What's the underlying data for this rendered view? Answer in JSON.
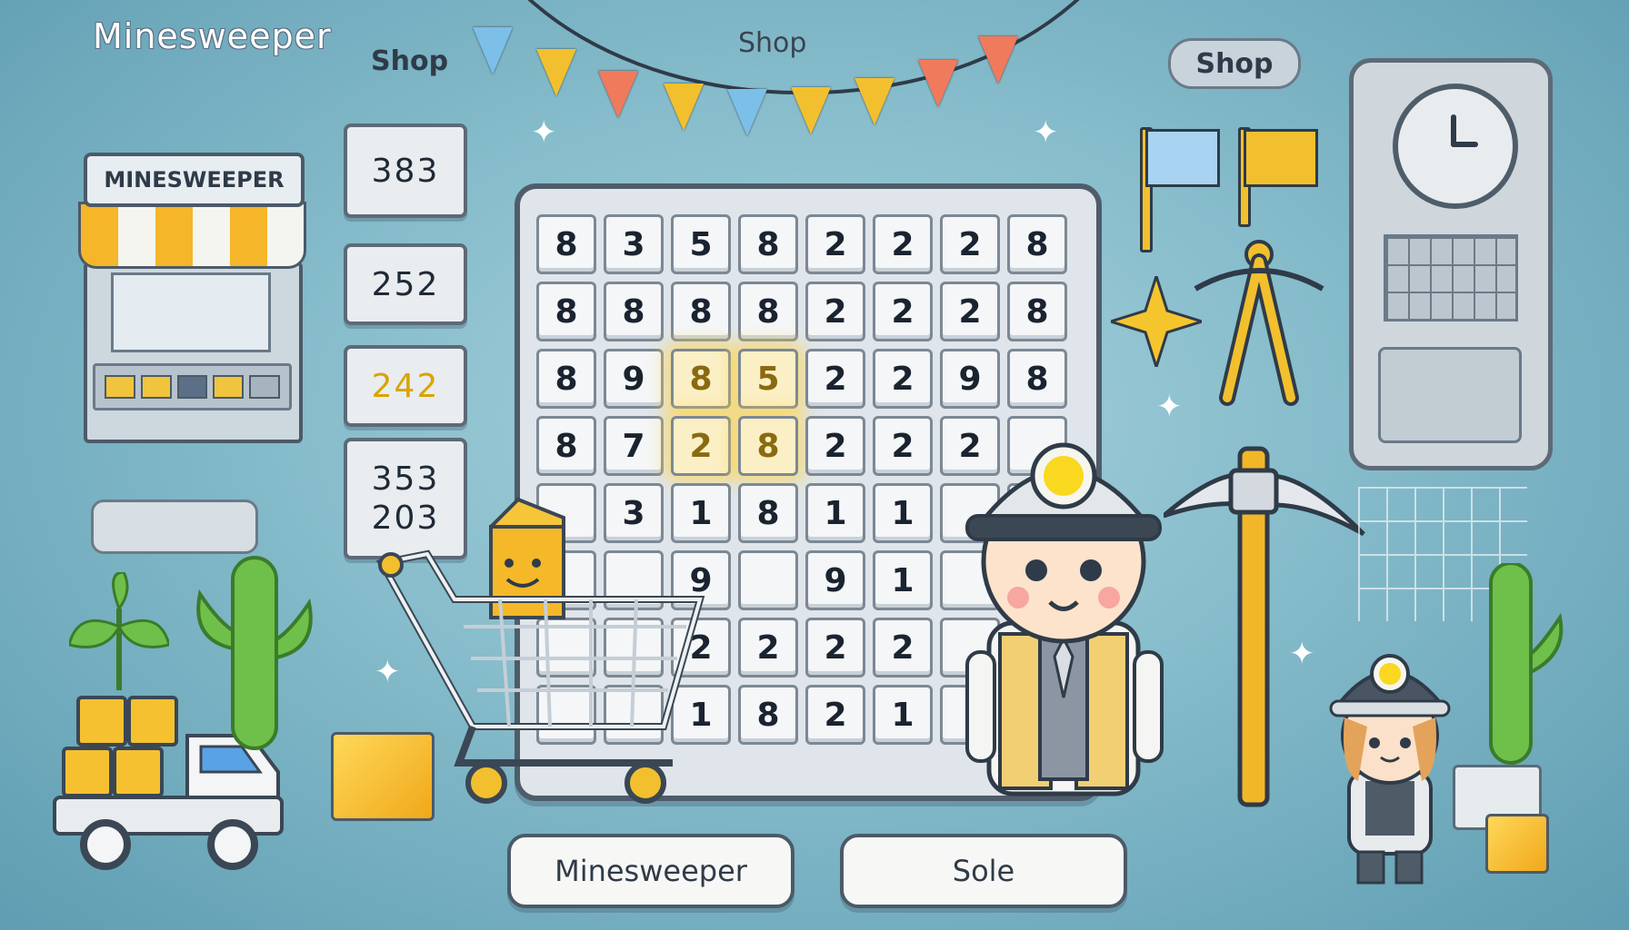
{
  "header": {
    "app_title": "Minesweeper",
    "shop_left": "Shop",
    "shop_center": "Shop",
    "shop_button": "Shop"
  },
  "stall": {
    "sign": "MINESWEEPER"
  },
  "panels": {
    "panel_1": "383",
    "panel_2": "252",
    "panel_3": "242",
    "panel_4_row1": "353",
    "panel_4_row2": "203"
  },
  "grid": {
    "rows": [
      [
        "8",
        "3",
        "5",
        "8",
        "2",
        "2",
        "2",
        "8"
      ],
      [
        "8",
        "8",
        "8",
        "8",
        "2",
        "2",
        "2",
        "8"
      ],
      [
        "8",
        "9",
        "8",
        "5",
        "2",
        "2",
        "9",
        "8"
      ],
      [
        "8",
        "7",
        "2",
        "8",
        "2",
        "2",
        "2",
        ""
      ],
      [
        "",
        "3",
        "1",
        "8",
        "1",
        "1",
        "",
        ""
      ],
      [
        "",
        "",
        "9",
        "",
        "9",
        "1",
        "",
        ""
      ],
      [
        "",
        "",
        "2",
        "2",
        "2",
        "2",
        "",
        ""
      ],
      [
        "",
        "",
        "1",
        "8",
        "2",
        "1",
        "",
        ""
      ]
    ],
    "highlighted": [
      [
        2,
        2
      ],
      [
        2,
        3
      ],
      [
        3,
        2
      ],
      [
        3,
        3
      ]
    ]
  },
  "buttons": {
    "minesweeper": "Minesweeper",
    "sole": "Sole"
  },
  "colors": {
    "background": "#86bccb",
    "accent_gold": "#f2c02e",
    "outline": "#4c5a68"
  },
  "icons": [
    "shop-stall-icon",
    "shopping-cart-icon",
    "gold-nugget-icon",
    "miner-character-icon",
    "pickaxe-icon",
    "blue-flag-icon",
    "yellow-flag-icon",
    "clock-icon",
    "delivery-truck-icon",
    "cactus-icon",
    "sparkle-icon"
  ]
}
